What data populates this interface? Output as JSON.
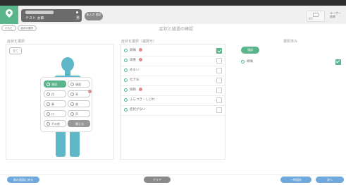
{
  "header": {
    "patient_id": "・・・・・・・・・",
    "patient_name": "テスト 太郎",
    "patient_sex": "男",
    "status_label": "未入力\n問診",
    "title": "症状と経過の確認",
    "settings_label": "設定",
    "user_line1": "ユーザー",
    "user_line2": "医師"
  },
  "breadcrumb": [
    "からだ",
    "症状の選択"
  ],
  "body_panel": {
    "title": "症状を選択",
    "all_button": "全て",
    "menu": [
      {
        "label": "頭部",
        "icon": "head-icon",
        "state": "active",
        "badge": false
      },
      {
        "label": "顔面",
        "icon": "face-icon",
        "state": "normal",
        "badge": false
      },
      {
        "label": "目",
        "icon": "eye-icon",
        "state": "normal",
        "badge": false
      },
      {
        "label": "耳",
        "icon": "ear-icon",
        "state": "normal",
        "badge": true
      },
      {
        "label": "鼻",
        "icon": "nose-icon",
        "state": "normal",
        "badge": false
      },
      {
        "label": "歯",
        "icon": "tooth-icon",
        "state": "normal",
        "badge": false
      },
      {
        "label": "口",
        "icon": "mouth-icon",
        "state": "normal",
        "badge": false
      },
      {
        "label": "声",
        "icon": "voice-icon",
        "state": "normal",
        "badge": false
      },
      {
        "label": "その他",
        "icon": "other-icon",
        "state": "normal",
        "badge": false
      },
      {
        "label": "閉じる",
        "icon": "close-icon",
        "state": "grey",
        "badge": false
      }
    ]
  },
  "symptom_panel": {
    "title": "症状を選択（複数可）",
    "rows": [
      {
        "label": "頭痛",
        "tag": true,
        "checked": true
      },
      {
        "label": "頭重",
        "tag": true,
        "checked": false
      },
      {
        "label": "めまい",
        "tag": false,
        "checked": false
      },
      {
        "label": "吐き気",
        "tag": false,
        "checked": false
      },
      {
        "label": "微熱",
        "tag": true,
        "checked": false
      },
      {
        "label": "ふらつき・しびれ",
        "tag": false,
        "checked": false
      },
      {
        "label": "症状がない",
        "tag": false,
        "checked": false
      }
    ]
  },
  "right_panel": {
    "title": "選択済み",
    "tag_label": "頭部",
    "rows": [
      {
        "label": "頭痛",
        "checked": true
      }
    ]
  },
  "footer": {
    "left_button": "前の画面に戻る",
    "center_button": "クリア",
    "right_button1": "一時保存",
    "right_button2": "次へ"
  },
  "colors": {
    "accent": "#5ab48c",
    "figure": "#5fb8c8",
    "badge": "#e08a8a",
    "footer_button": "#6fa8dc",
    "center_button": "#8a8a8a"
  }
}
